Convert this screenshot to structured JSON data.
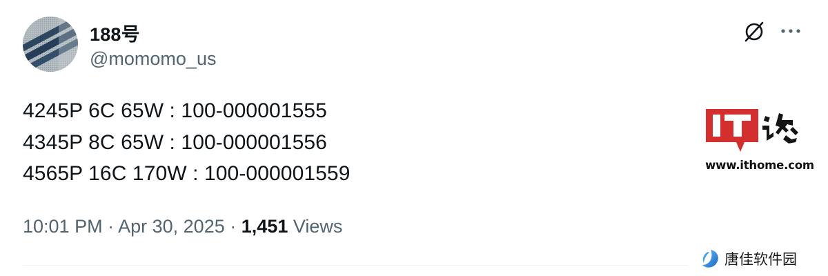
{
  "author": {
    "display_name": "188号",
    "handle": "@momomo_us"
  },
  "icons": {
    "avatar": "avatar-image",
    "grok": "grok-icon",
    "more": "more-horizontal-icon"
  },
  "tweet": {
    "lines": [
      "4245P 6C 65W : 100-000001555",
      "4345P 8C 65W : 100-000001556",
      "4565P 16C 170W : 100-000001559"
    ],
    "time": "10:01 PM",
    "separator": "·",
    "date": "Apr 30, 2025",
    "views_count": "1,451",
    "views_label": "Views"
  },
  "watermarks": {
    "ithome_logo_text": "IT之家",
    "ithome_url": "www.ithome.com",
    "tangjia": "唐佳软件园"
  },
  "colors": {
    "text_primary": "#0f1419",
    "text_secondary": "#536471",
    "ithome_red": "#d32f2f"
  }
}
